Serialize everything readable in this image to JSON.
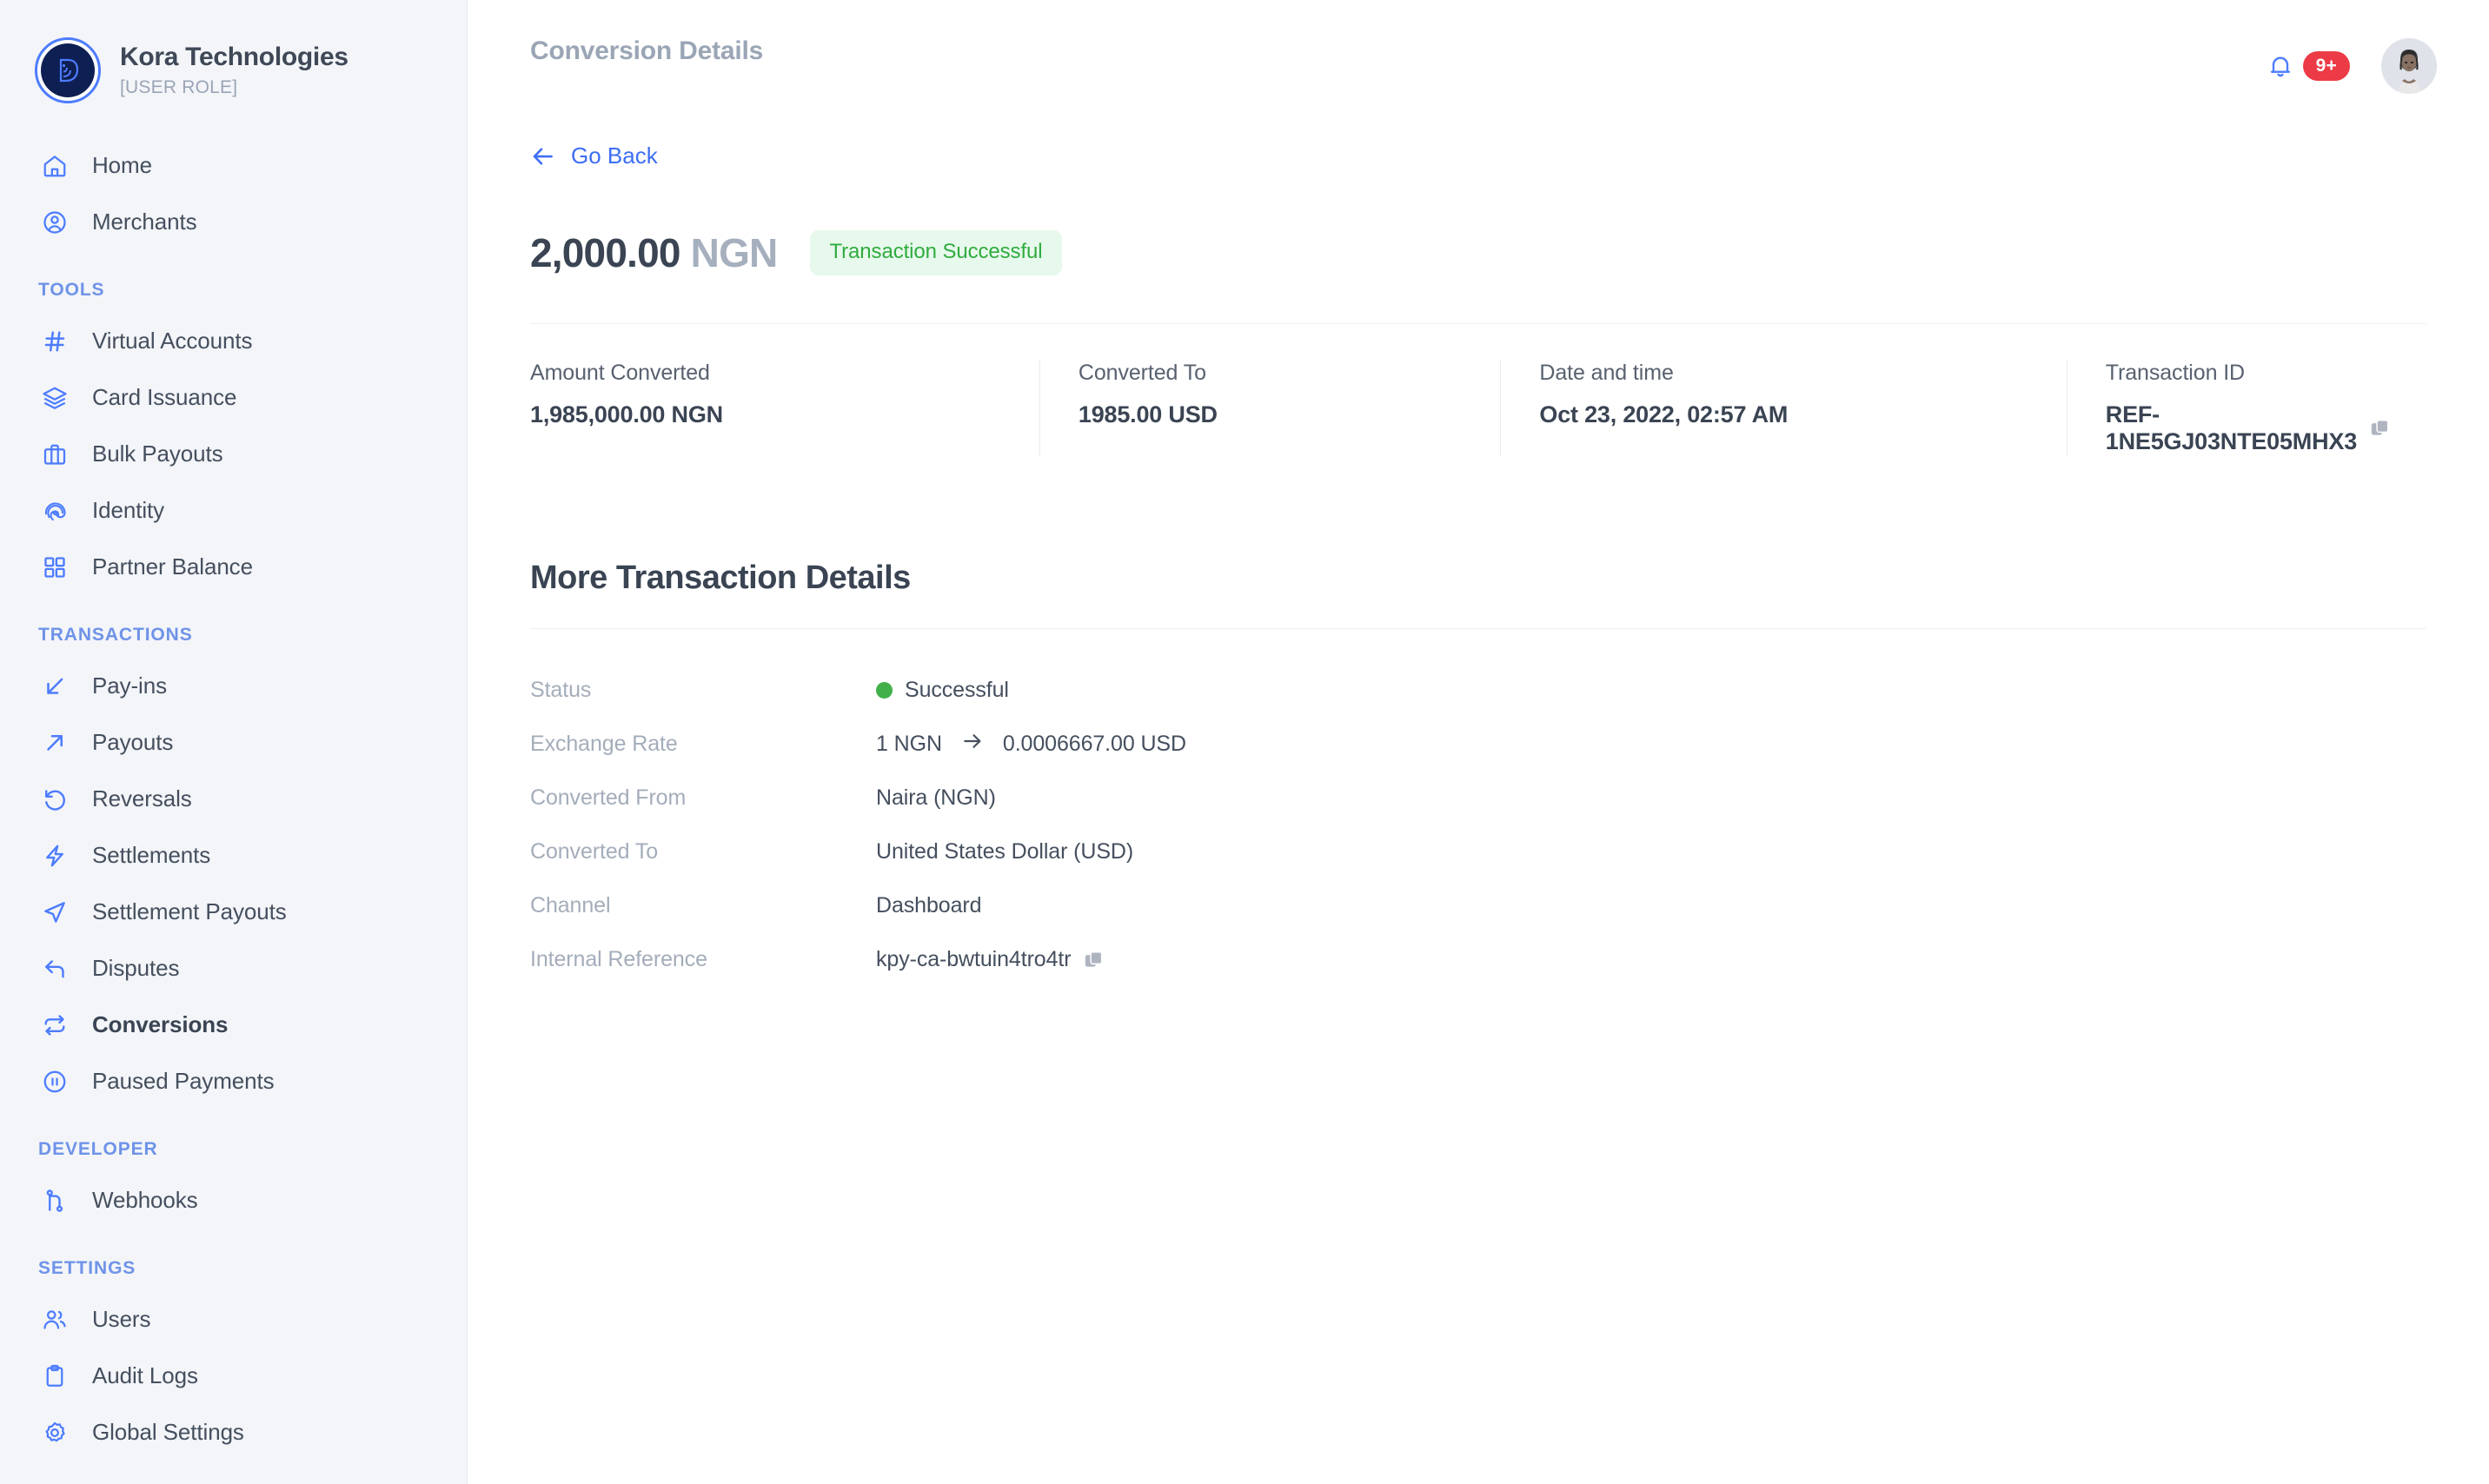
{
  "brand": {
    "name": "Kora Technologies",
    "role": "[USER ROLE]",
    "logo_icon": "kora-logo-icon"
  },
  "sidebar": {
    "groups": [
      {
        "title": null,
        "items": [
          {
            "label": "Home",
            "icon": "home-icon",
            "active": false
          },
          {
            "label": "Merchants",
            "icon": "user-circle-icon",
            "active": false
          }
        ]
      },
      {
        "title": "TOOLS",
        "items": [
          {
            "label": "Virtual Accounts",
            "icon": "hash-icon",
            "active": false
          },
          {
            "label": "Card Issuance",
            "icon": "layers-icon",
            "active": false
          },
          {
            "label": "Bulk Payouts",
            "icon": "briefcase-icon",
            "active": false
          },
          {
            "label": "Identity",
            "icon": "fingerprint-icon",
            "active": false
          },
          {
            "label": "Partner Balance",
            "icon": "grid-icon",
            "active": false
          }
        ]
      },
      {
        "title": "TRANSACTIONS",
        "items": [
          {
            "label": "Pay-ins",
            "icon": "arrow-down-left-icon",
            "active": false
          },
          {
            "label": "Payouts",
            "icon": "arrow-up-right-icon",
            "active": false
          },
          {
            "label": "Reversals",
            "icon": "rotate-ccw-icon",
            "active": false
          },
          {
            "label": "Settlements",
            "icon": "zap-icon",
            "active": false
          },
          {
            "label": "Settlement Payouts",
            "icon": "send-icon",
            "active": false
          },
          {
            "label": "Disputes",
            "icon": "corner-up-left-icon",
            "active": false
          },
          {
            "label": "Conversions",
            "icon": "repeat-icon",
            "active": true
          },
          {
            "label": "Paused Payments",
            "icon": "pause-circle-icon",
            "active": false
          }
        ]
      },
      {
        "title": "DEVELOPER",
        "items": [
          {
            "label": "Webhooks",
            "icon": "git-branch-icon",
            "active": false
          }
        ]
      },
      {
        "title": "SETTINGS",
        "items": [
          {
            "label": "Users",
            "icon": "users-icon",
            "active": false
          },
          {
            "label": "Audit Logs",
            "icon": "clipboard-icon",
            "active": false
          },
          {
            "label": "Global Settings",
            "icon": "gear-icon",
            "active": false
          }
        ]
      }
    ]
  },
  "topbar": {
    "page_title": "Conversion Details",
    "bell_icon": "bell-icon",
    "notification_count": "9+",
    "avatar_icon": "user-avatar"
  },
  "go_back": {
    "label": "Go Back",
    "icon": "arrow-left-icon"
  },
  "amount": {
    "value": "2,000.00",
    "currency": "NGN",
    "status_pill": "Transaction Successful"
  },
  "summary": {
    "cards": [
      {
        "label": "Amount Converted",
        "value": "1,985,000.00 NGN",
        "copyable": false
      },
      {
        "label": "Converted To",
        "value": "1985.00 USD",
        "copyable": false
      },
      {
        "label": "Date and time",
        "value": "Oct 23, 2022,  02:57 AM",
        "copyable": false
      },
      {
        "label": "Transaction ID",
        "value": "REF-1NE5GJ03NTE05MHX3",
        "copyable": true
      }
    ]
  },
  "details": {
    "heading": "More Transaction Details",
    "rows": [
      {
        "key": "Status",
        "value": "Successful",
        "kind": "status"
      },
      {
        "key": "Exchange Rate",
        "value": "1 NGN",
        "value2": "0.0006667.00 USD",
        "kind": "rate"
      },
      {
        "key": "Converted From",
        "value": "Naira (NGN)",
        "kind": "text"
      },
      {
        "key": "Converted To",
        "value": "United States Dollar (USD)",
        "kind": "text"
      },
      {
        "key": "Channel",
        "value": "Dashboard",
        "kind": "text"
      },
      {
        "key": "Internal Reference",
        "value": "kpy-ca-bwtuin4tro4tr",
        "kind": "copy"
      }
    ]
  },
  "colors": {
    "accent_blue": "#4d7cfe",
    "link_blue": "#3d6ef5",
    "sidebar_bg": "#f3f5f9",
    "success_green": "#2fac3e",
    "success_bg": "#e7f8ec",
    "status_dot": "#41b04a",
    "badge_red": "#ec3b46",
    "text_dark": "#3a4453",
    "text_muted": "#a4adba"
  }
}
